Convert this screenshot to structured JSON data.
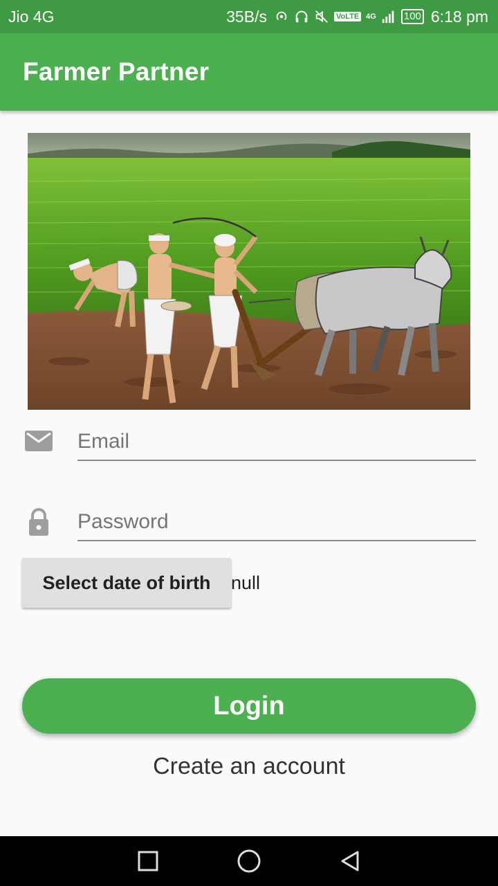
{
  "status_bar": {
    "carrier": "Jio 4G",
    "speed": "35B/s",
    "volte": "VoLTE",
    "network": "4G",
    "battery": "100",
    "time": "6:18 pm"
  },
  "app_bar": {
    "title": "Farmer Partner"
  },
  "hero": {
    "icon": "farmers-ploughing-illustration"
  },
  "form": {
    "email_placeholder": "Email",
    "email_value": "",
    "password_placeholder": "Password",
    "password_value": "",
    "dob_button_label": "Select date of birth",
    "dob_value": "null"
  },
  "actions": {
    "login_label": "Login",
    "create_account_label": "Create an account"
  },
  "colors": {
    "primary": "#4caf50",
    "primary_dark": "#3f9b43",
    "background": "#fafafa"
  },
  "nav_bar": {
    "icons": [
      "recents-icon",
      "home-icon",
      "back-icon"
    ]
  }
}
